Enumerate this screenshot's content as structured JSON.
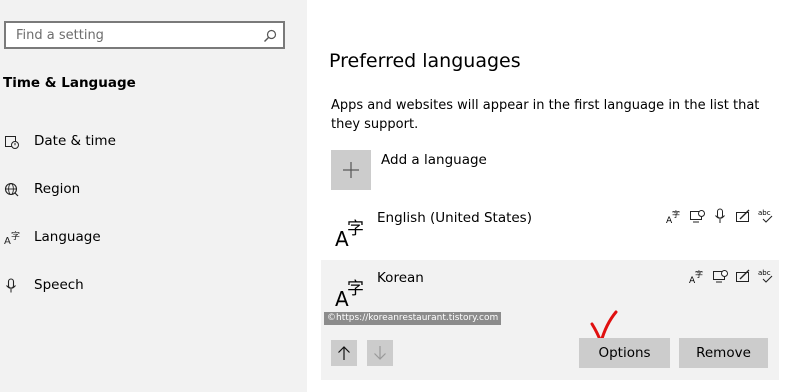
{
  "sidebar": {
    "search_placeholder": "Find a setting",
    "section_title": "Time & Language",
    "items": [
      {
        "label": "Date & time",
        "icon": "calendar-clock-icon"
      },
      {
        "label": "Region",
        "icon": "globe-icon"
      },
      {
        "label": "Language",
        "icon": "language-icon"
      },
      {
        "label": "Speech",
        "icon": "microphone-icon"
      }
    ]
  },
  "main": {
    "heading": "Preferred languages",
    "description": "Apps and websites will appear in the first language in the list that they support.",
    "add_language_label": "Add a language",
    "languages": [
      {
        "name": "English (United States)",
        "features": [
          "display-language-icon",
          "text-to-speech-icon",
          "speech-recognition-icon",
          "handwriting-icon",
          "spell-check-icon"
        ]
      },
      {
        "name": "Korean",
        "features": [
          "display-language-icon",
          "text-to-speech-icon",
          "handwriting-icon",
          "spell-check-icon"
        ],
        "selected": true
      }
    ],
    "options_label": "Options",
    "remove_label": "Remove",
    "watermark": "©https://koreanrestaurant.tistory.com"
  },
  "colors": {
    "sidebar_bg": "#f2f2f2",
    "button_bg": "#cccccc",
    "annotation": "#e01010"
  }
}
